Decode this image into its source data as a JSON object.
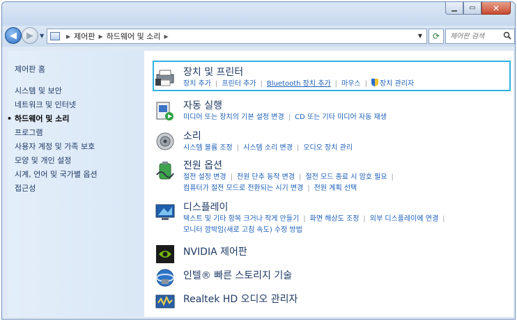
{
  "address": {
    "crumbs": [
      "제어판",
      "하드웨어 및 소리"
    ],
    "search_placeholder": "제어판 검색"
  },
  "left_nav": {
    "home": "제어판 홈",
    "items": [
      {
        "label": "시스템 및 보안"
      },
      {
        "label": "네트워크 및 인터넷"
      },
      {
        "label": "하드웨어 및 소리",
        "current": true
      },
      {
        "label": "프로그램"
      },
      {
        "label": "사용자 계정 및 가족 보호"
      },
      {
        "label": "모양 및 개인 설정"
      },
      {
        "label": "시계, 언어 및 국가별 옵션"
      },
      {
        "label": "접근성"
      }
    ]
  },
  "categories": {
    "devices": {
      "title": "장치 및 프린터",
      "links": [
        "장치 추가",
        "프린터 추가",
        "Bluetooth 장치 추가",
        "마우스",
        "장치 관리자"
      ],
      "icon": "printer-icon"
    },
    "autoplay": {
      "title": "자동 실행",
      "links": [
        "미디어 또는 장치의 기본 설정 변경",
        "CD 또는 기타 미디어 자동 재생"
      ],
      "icon": "autoplay-icon"
    },
    "sound": {
      "title": "소리",
      "links": [
        "시스템 볼륨 조정",
        "시스템 소리 변경",
        "오디오 장치 관리"
      ],
      "icon": "speaker-icon"
    },
    "power": {
      "title": "전원 옵션",
      "links": [
        "절전 설정 변경",
        "전원 단추 동작 변경",
        "절전 모드 종료 시 암호 필요",
        "컴퓨터가 절전 모드로 전환되는 시기 변경",
        "전원 계획 선택"
      ],
      "icon": "battery-icon"
    },
    "display": {
      "title": "디스플레이",
      "links": [
        "텍스트 및 기타 항목 크거나 작게 만들기",
        "화면 해상도 조정",
        "외부 디스플레이에 연결",
        "모니터 깜박임(새로 고침 속도) 수정 방법"
      ],
      "icon": "monitor-icon"
    },
    "nvidia": {
      "title": "NVIDIA 제어판",
      "icon": "nvidia-icon"
    },
    "intel": {
      "title": "인텔® 빠른 스토리지 기술",
      "icon": "intel-storage-icon"
    },
    "realtek": {
      "title": "Realtek HD 오디오 관리자",
      "icon": "realtek-audio-icon"
    }
  },
  "colors": {
    "highlight_border": "#2fb3e4",
    "link": "#1c5fb8",
    "title": "#1e3964"
  }
}
